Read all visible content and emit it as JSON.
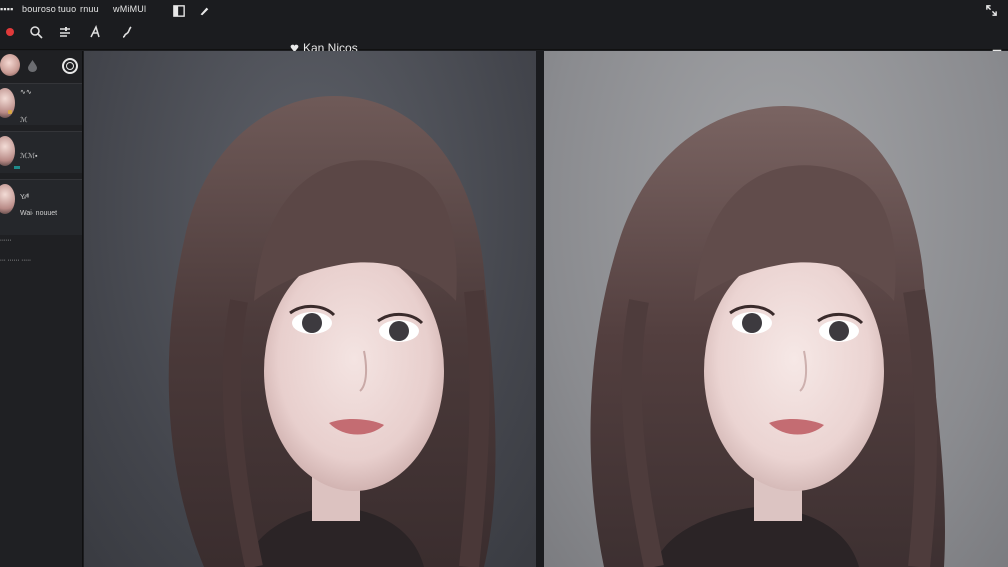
{
  "menubar": {
    "items": [
      "▪▪▪▪",
      "bouroso",
      "tuuo",
      "rnuu",
      "wMiMUl"
    ]
  },
  "toolbar": {
    "tools": [
      {
        "name": "record",
        "icon": "record-dot-icon",
        "color": "#e03a3a"
      },
      {
        "name": "search",
        "icon": "search-icon"
      },
      {
        "name": "adjust",
        "icon": "sliders-icon"
      },
      {
        "name": "text",
        "icon": "text-tool-icon"
      },
      {
        "name": "brush",
        "icon": "brush-icon"
      }
    ]
  },
  "document": {
    "title": "Kan Nicos"
  },
  "sidebar": {
    "layers": [
      {
        "label": "∿∿",
        "sublabel": "ℳ"
      },
      {
        "label": "ℳℳ▪"
      },
      {
        "label": "Y∕⁄ᴵᴵ",
        "sublabel": "Wai∙ nouuet"
      }
    ],
    "info": [
      "∙∙∙∙∙∙",
      "∙∙∙ ∙∙∙∙∙∙ ∙∙∙∙∙"
    ]
  },
  "colors": {
    "app_bg": "#1c1d20",
    "left_canvas": "#4a4c53",
    "right_canvas": "#8d8e92",
    "accent_red": "#e03a3a"
  }
}
